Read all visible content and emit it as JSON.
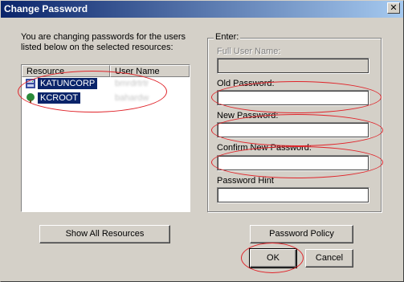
{
  "window": {
    "title": "Change Password",
    "close_glyph": "✕"
  },
  "intro_text": "You are changing passwords for the users listed below on the selected resources:",
  "resource_list": {
    "columns": [
      "Resource",
      "User Name"
    ],
    "rows": [
      {
        "resource": "KATUNCORP",
        "user": "bmrdrtrtr",
        "icon": "server-icon",
        "selected": true
      },
      {
        "resource": "KCROOT",
        "user": "bahardw",
        "icon": "tree-icon",
        "selected": true
      }
    ]
  },
  "group": {
    "legend": "Enter:",
    "full_user_name": {
      "label": "Full User Name:",
      "value": "",
      "enabled": false
    },
    "old_password": {
      "label": "Old Password:",
      "value": ""
    },
    "new_password": {
      "label": "New Password:",
      "value": ""
    },
    "confirm_password": {
      "label": "Confirm New Password:",
      "value": ""
    },
    "password_hint": {
      "label": "Password Hint",
      "value": ""
    }
  },
  "buttons": {
    "show_all": "Show All Resources",
    "policy": "Password Policy",
    "ok": "OK",
    "cancel": "Cancel"
  },
  "colors": {
    "dialog_bg": "#d4d0c8",
    "titlebar_start": "#0a246a",
    "titlebar_end": "#a6caf0",
    "selection": "#0a246a",
    "annotation": "#e0242a"
  }
}
